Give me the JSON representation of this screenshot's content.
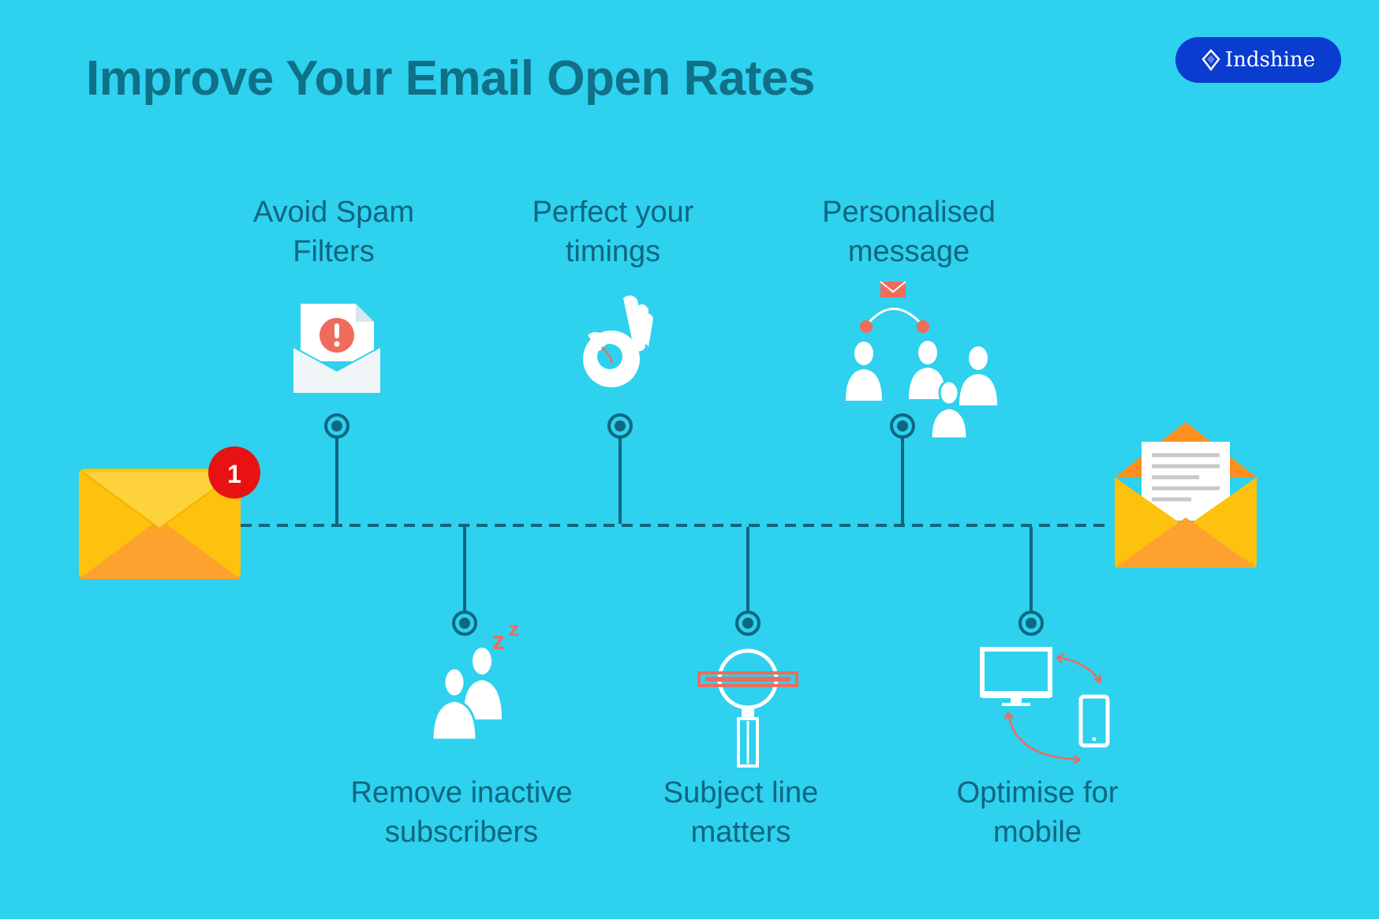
{
  "title": "Improve Your Email Open Rates",
  "brand": {
    "name": "Indshine",
    "icon": "diamond-icon",
    "color": "#0a3ccf"
  },
  "notification_badge": "1",
  "steps_top": [
    {
      "line1": "Avoid Spam",
      "line2": "Filters",
      "icon": "spam-alert-envelope-icon"
    },
    {
      "line1": "Perfect your",
      "line2": "timings",
      "icon": "ok-hand-clock-icon"
    },
    {
      "line1": "Personalised",
      "line2": "message",
      "icon": "group-message-icon"
    }
  ],
  "steps_bottom": [
    {
      "line1": "Remove inactive",
      "line2": "subscribers",
      "icon": "sleeping-users-icon"
    },
    {
      "line1": "Subject line",
      "line2": "matters",
      "icon": "magnifier-subject-icon"
    },
    {
      "line1": "Optimise for",
      "line2": "mobile",
      "icon": "desktop-mobile-sync-icon"
    }
  ],
  "colors": {
    "background": "#2ed1ee",
    "heading": "#0f7087",
    "line": "#0f6680",
    "accent": "#ef6b5b",
    "envelope_yellow": "#fdc20d",
    "envelope_orange": "#fda12f",
    "badge": "#e81212"
  }
}
